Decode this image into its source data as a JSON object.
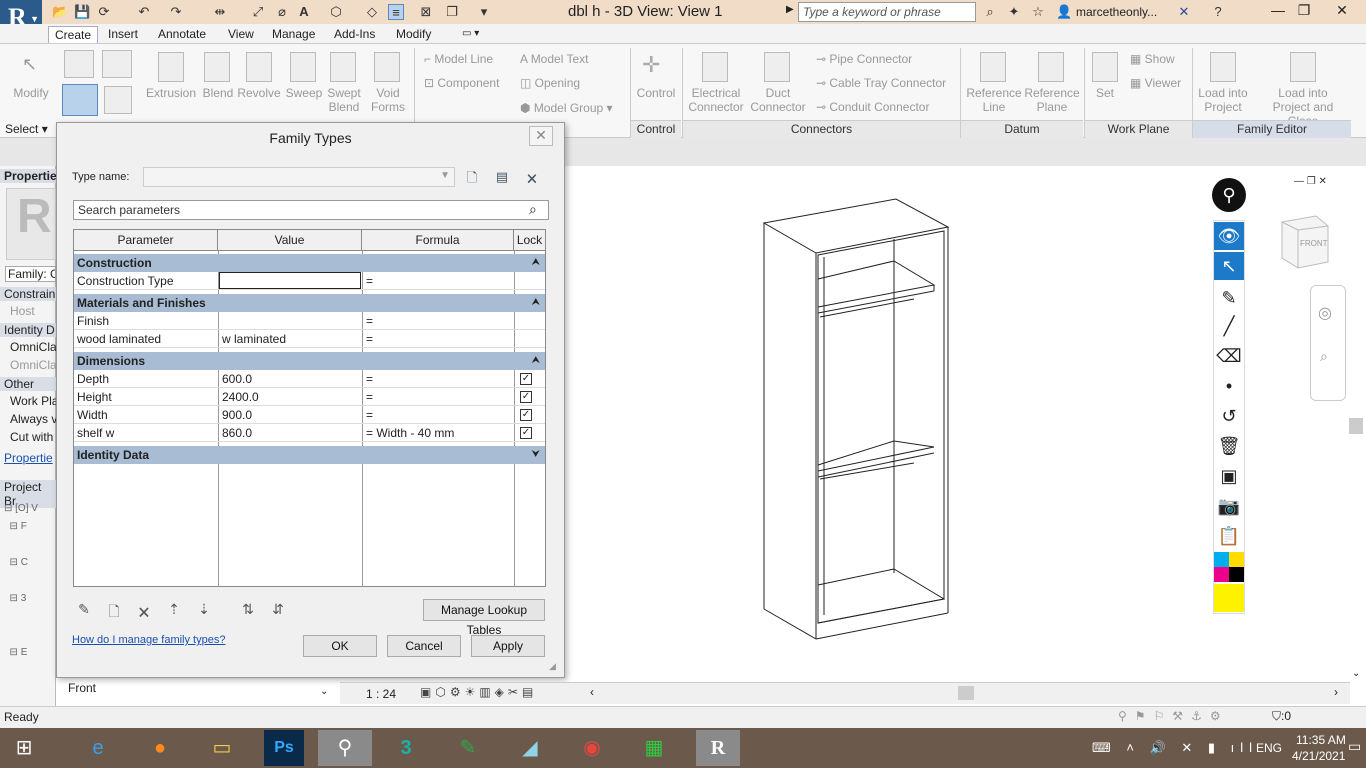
{
  "window": {
    "title": "dbl h - 3D View: View 1",
    "search_placeholder": "Type a keyword or phrase",
    "user": "marcetheonly...",
    "app_logo": "R"
  },
  "tabs": [
    "Create",
    "Insert",
    "Annotate",
    "View",
    "Manage",
    "Add-Ins",
    "Modify"
  ],
  "ribbon": {
    "select_label": "Select",
    "modify_label": "Modify",
    "forms": [
      "Extrusion",
      "Blend",
      "Revolve",
      "Sweep",
      "Swept\nBlend",
      "Void\nForms"
    ],
    "model": [
      "Model Line",
      "Component",
      "Model Text",
      "Opening",
      "Model Group"
    ],
    "control": "Control",
    "connectors": [
      "Electrical\nConnector",
      "Duct\nConnector",
      "Pipe Connector",
      "Cable Tray Connector",
      "Conduit Connector"
    ],
    "datum": [
      "Reference\nLine",
      "Reference\nPlane"
    ],
    "workplane": [
      "Set",
      "Show",
      "Viewer"
    ],
    "family_editor": [
      "Load into\nProject",
      "Load into\nProject and Close"
    ],
    "panels": [
      "Control",
      "Connectors",
      "Datum",
      "Work Plane",
      "Family Editor"
    ]
  },
  "left_panel": {
    "properties": "Properties",
    "family": "Family: C",
    "constraints": "Constrain",
    "host": "Host",
    "identity": "Identity D",
    "omni1": "OmniCla",
    "omni2": "OmniCla",
    "other": "Other",
    "work_plane": "Work Pla",
    "always": "Always v",
    "cut_with": "Cut with",
    "properties_link": "Propertie",
    "project_browser": "Project Br",
    "front": "Front"
  },
  "dialog": {
    "title": "Family Types",
    "type_name_label": "Type name:",
    "search_placeholder": "Search parameters",
    "columns": [
      "Parameter",
      "Value",
      "Formula",
      "Lock"
    ],
    "groups": {
      "construction": "Construction",
      "materials": "Materials and Finishes",
      "dimensions": "Dimensions",
      "identity": "Identity Data"
    },
    "rows": {
      "construction_type": {
        "param": "Construction Type",
        "value": "",
        "formula": "="
      },
      "finish": {
        "param": "Finish",
        "value": "",
        "formula": "="
      },
      "wood": {
        "param": "wood laminated",
        "value": "w laminated",
        "formula": "="
      },
      "depth": {
        "param": "Depth",
        "value": "600.0",
        "formula": "="
      },
      "height": {
        "param": "Height",
        "value": "2400.0",
        "formula": "="
      },
      "width": {
        "param": "Width",
        "value": "900.0",
        "formula": "="
      },
      "shelf": {
        "param": "shelf w",
        "value": "860.0",
        "formula": "= Width - 40 mm"
      }
    },
    "manage_lookup": "Manage Lookup Tables",
    "help_link": "How do I manage family types?",
    "ok": "OK",
    "cancel": "Cancel",
    "apply": "Apply"
  },
  "view": {
    "scale": "1 : 24",
    "cube_label": "FRONT"
  },
  "status": {
    "text": "Ready",
    "filter_count": ":0"
  },
  "taskbar": {
    "time": "11:35 AM",
    "date": "4/21/2021",
    "lang": "ENG"
  }
}
